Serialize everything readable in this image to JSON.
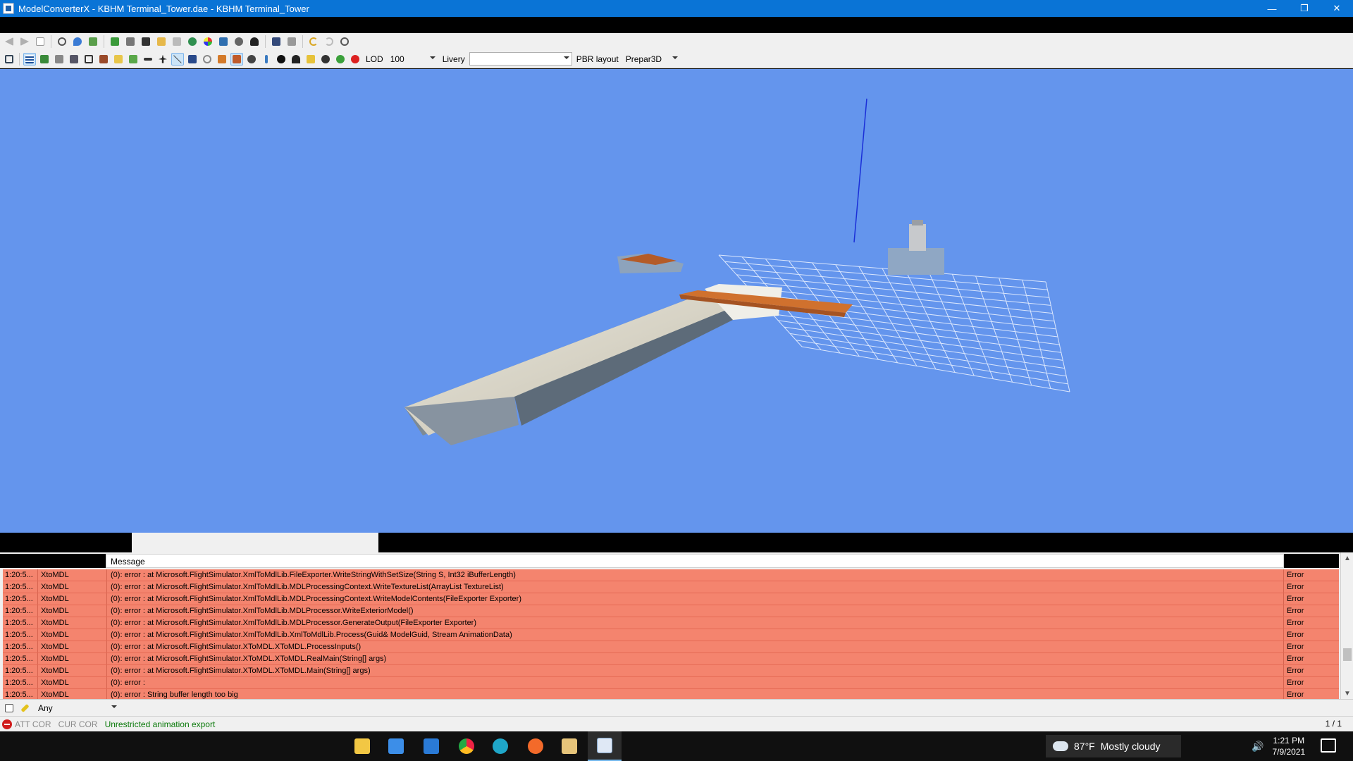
{
  "window": {
    "title": "ModelConverterX - KBHM Terminal_Tower.dae - KBHM Terminal_Tower",
    "minimize": "—",
    "restore": "❐",
    "close": "✕"
  },
  "toolbar": {
    "lod_label": "LOD",
    "lod_value": "100",
    "livery_label": "Livery",
    "livery_value": "",
    "pbr_label": "PBR layout",
    "pbr_value": "Prepar3D"
  },
  "log": {
    "header_message": "Message",
    "rows": [
      {
        "time": "1:20:5...",
        "source": "XtoMDL",
        "message": "(0): error :    at Microsoft.FlightSimulator.XmlToMdlLib.FileExporter.WriteStringWithSetSize(String S, Int32 iBufferLength)",
        "level": "Error"
      },
      {
        "time": "1:20:5...",
        "source": "XtoMDL",
        "message": "(0): error :    at Microsoft.FlightSimulator.XmlToMdlLib.MDLProcessingContext.WriteTextureList(ArrayList TextureList)",
        "level": "Error"
      },
      {
        "time": "1:20:5...",
        "source": "XtoMDL",
        "message": "(0): error :    at Microsoft.FlightSimulator.XmlToMdlLib.MDLProcessingContext.WriteModelContents(FileExporter Exporter)",
        "level": "Error"
      },
      {
        "time": "1:20:5...",
        "source": "XtoMDL",
        "message": "(0): error :    at Microsoft.FlightSimulator.XmlToMdlLib.MDLProcessor.WriteExteriorModel()",
        "level": "Error"
      },
      {
        "time": "1:20:5...",
        "source": "XtoMDL",
        "message": "(0): error :    at Microsoft.FlightSimulator.XmlToMdlLib.MDLProcessor.GenerateOutput(FileExporter Exporter)",
        "level": "Error"
      },
      {
        "time": "1:20:5...",
        "source": "XtoMDL",
        "message": "(0): error :    at Microsoft.FlightSimulator.XmlToMdlLib.XmlToMdlLib.Process(Guid& ModelGuid, Stream AnimationData)",
        "level": "Error"
      },
      {
        "time": "1:20:5...",
        "source": "XtoMDL",
        "message": "(0): error :    at Microsoft.FlightSimulator.XToMDL.XToMDL.ProcessInputs()",
        "level": "Error"
      },
      {
        "time": "1:20:5...",
        "source": "XtoMDL",
        "message": "(0): error :    at Microsoft.FlightSimulator.XToMDL.XToMDL.RealMain(String[] args)",
        "level": "Error"
      },
      {
        "time": "1:20:5...",
        "source": "XtoMDL",
        "message": "(0): error :    at Microsoft.FlightSimulator.XToMDL.XToMDL.Main(String[] args)",
        "level": "Error"
      },
      {
        "time": "1:20:5...",
        "source": "XtoMDL",
        "message": "(0): error :",
        "level": "Error"
      },
      {
        "time": "1:20:5...",
        "source": "XtoMDL",
        "message": "(0): error : String buffer length too big",
        "level": "Error"
      }
    ]
  },
  "filter": {
    "value": "Any"
  },
  "status": {
    "att": "ATT COR",
    "cur": "CUR COR",
    "message": "Unrestricted animation export",
    "page": "1 / 1"
  },
  "taskbar": {
    "weather_temp": "87°F",
    "weather_desc": "Mostly cloudy",
    "time": "1:21 PM",
    "date": "7/9/2021"
  },
  "colors": {
    "titlebar": "#0a74d6",
    "viewport_bg": "#6495ed",
    "error_row": "#f4846e"
  }
}
